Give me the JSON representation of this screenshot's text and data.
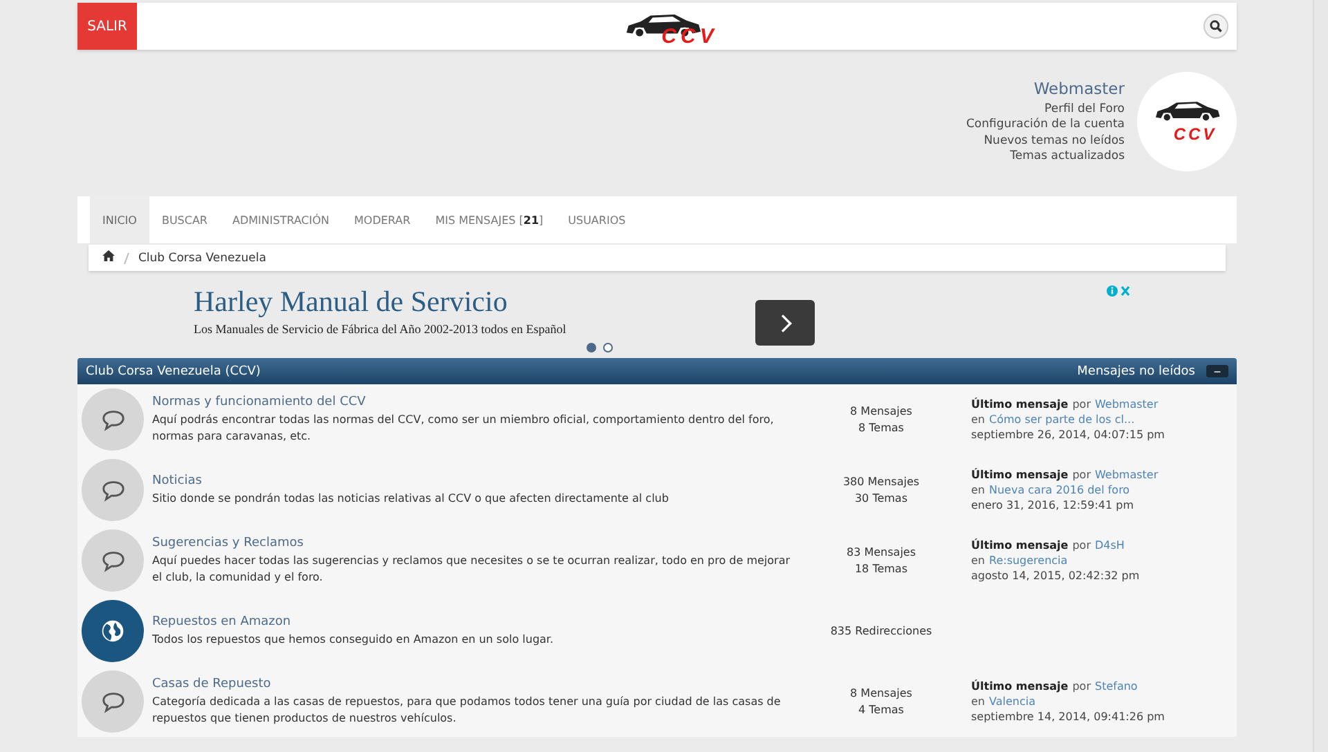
{
  "header": {
    "logout_button": "SALIR",
    "logo_text": "CCV"
  },
  "user": {
    "name": "Webmaster",
    "links": [
      "Perfil del Foro",
      "Configuración de la cuenta",
      "Nuevos temas no leídos",
      "Temas actualizados"
    ],
    "avatar_text": "CCV"
  },
  "nav": [
    {
      "label": "INICIO",
      "selected": true
    },
    {
      "label": "BUSCAR",
      "selected": false
    },
    {
      "label": "ADMINISTRACIÓN",
      "selected": false
    },
    {
      "label": "MODERAR",
      "selected": false
    },
    {
      "label": "MIS MENSAJES [**21**]",
      "selected": false
    },
    {
      "label": "USUARIOS",
      "selected": false
    }
  ],
  "breadcrumb": [
    "Club Corsa Venezuela"
  ],
  "ad": {
    "title": "Harley Manual de Servicio",
    "subtitle": "Los Manuales de Servicio de Fábrica del Año 2002-2013 todos en Español",
    "slides": [
      {
        "selected": true
      },
      {
        "selected": false
      }
    ]
  },
  "category": {
    "title": "Club Corsa Venezuela (CCV)",
    "unread_link": "Mensajes no leídos",
    "collapse": "−",
    "boards": [
      {
        "kind": "board",
        "name": "Normas y funcionamiento del CCV",
        "description": "Aquí podrás encontrar todas las normas del CCV, como ser un miembro oficial, comportamiento dentro del foro, normas para caravanas, etc.",
        "stats": [
          "8 Mensajes",
          "8 Temas"
        ],
        "last_post": {
          "label": "Último mensaje",
          "by": "por",
          "author": "Webmaster",
          "in": "en",
          "topic": "Cómo ser parte de los cl...",
          "date": "septiembre 26, 2014, 04:07:15 pm"
        }
      },
      {
        "kind": "board",
        "name": "Noticias",
        "description": "Sitio donde se pondrán todas las noticias relativas al CCV o que afecten directamente al club",
        "stats": [
          "380 Mensajes",
          "30 Temas"
        ],
        "last_post": {
          "label": "Último mensaje",
          "by": "por",
          "author": "Webmaster",
          "in": "en",
          "topic": "Nueva cara 2016 del foro",
          "date": "enero 31, 2016, 12:59:41 pm"
        }
      },
      {
        "kind": "board",
        "name": "Sugerencias y Reclamos",
        "description": "Aquí puedes hacer todas las sugerencias y reclamos que necesites o se te ocurran realizar, todo en pro de mejorar el club, la comunidad y el foro.",
        "stats": [
          "83 Mensajes",
          "18 Temas"
        ],
        "last_post": {
          "label": "Último mensaje",
          "by": "por",
          "author": "D4sH",
          "in": "en",
          "topic": "Re:sugerencia",
          "date": "agosto 14, 2015, 02:42:32 pm"
        }
      },
      {
        "kind": "redirect",
        "name": "Repuestos en Amazon",
        "description": "Todos los repuestos que hemos conseguido en Amazon en un solo lugar.",
        "stats": [
          "835 Redirecciones"
        ]
      },
      {
        "kind": "board",
        "name": "Casas de Repuesto",
        "description": "Categoría dedicada a las casas de repuestos, para que podamos todos tener una guía por ciudad de las casas de repuestos que tienen productos de nuestros vehículos.",
        "stats": [
          "8 Mensajes",
          "4 Temas"
        ],
        "last_post": {
          "label": "Último mensaje",
          "by": "por",
          "author": "Stefano",
          "in": "en",
          "topic": "Valencia",
          "date": "septiembre 14, 2014, 09:41:26 pm"
        }
      }
    ]
  }
}
